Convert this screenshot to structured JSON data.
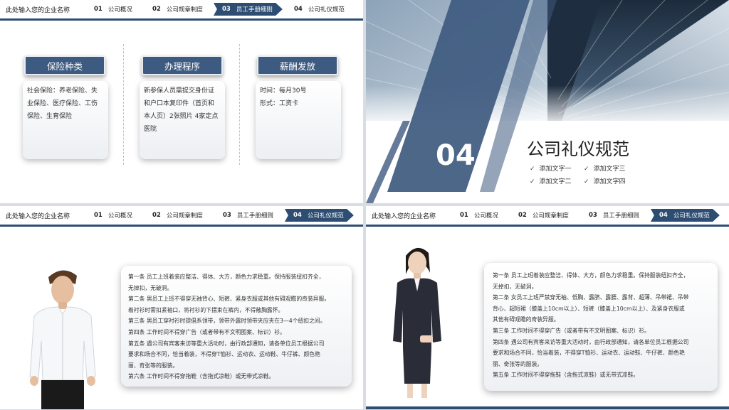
{
  "header": {
    "company": "此处输入您的企业名称",
    "nav": [
      {
        "num": "01",
        "label": "公司概况"
      },
      {
        "num": "02",
        "label": "公司规章制度"
      },
      {
        "num": "03",
        "label": "员工手册细则"
      },
      {
        "num": "04",
        "label": "公司礼仪规范"
      }
    ]
  },
  "slide1": {
    "columns": [
      {
        "title": "保险种类",
        "lines": [
          "社会保险：养老保险、失",
          "业保险、医疗保险、工伤",
          "保险、生育保险"
        ]
      },
      {
        "title": "办理程序",
        "lines": [
          "新参保人员需提交身份证",
          "和户口本复印件（首页和",
          "本人页）2张照片 4家定点",
          "医院"
        ]
      },
      {
        "title": "薪酬发放",
        "lines": [
          "时间：每月30号",
          "形式：工资卡"
        ]
      }
    ]
  },
  "slide2": {
    "number": "04",
    "title": "公司礼仪规范",
    "items": [
      "添加文字一",
      "添加文字三",
      "添加文字二",
      "添加文字四"
    ]
  },
  "slide3": {
    "lines": [
      "第一条 员工上班着装应整洁、得体、大方，颜色力求稳重。保持服装纽扣齐全，",
      "无掉扣，无破洞。",
      "第二条 男员工上班不得穿无袖背心、短裤、紧身衣服或其他有碍观瞻的奇装异服。",
      "着衬衫时需扣紧袖口，将衬衫的下摆束在裤内，不得敞胸露怀。",
      "第三条 男员工穿衬衫时提倡系领带，领带外露时领带夹应夹在3—4个纽扣之间。",
      "第四条 工作时间不得穿广告（或者带有不文明图案、标识）衫。",
      "第五条 遇公司有宾客来访等重大活动时，由行政部通知，请各单位员工根据公司",
      "要求和场合不同，恰当着装，不得穿T恤衫、运动衣、运动鞋、牛仔裤、颜色艳",
      "丽、奇张等的服装。",
      "第六条 工作时间不得穿拖鞋（含拖式凉鞋）或无带式凉鞋。"
    ]
  },
  "slide4": {
    "lines": [
      "第一条 员工上班着装应整洁、得体、大方，颜色力求稳重。保持服装纽扣齐全，",
      "无掉扣，无破洞。",
      "第二条 女员工上班严禁穿无袖、低胸、露脐、露腰、露背、超薄、吊带裙、吊带",
      "背心、超短裙（膝盖上10cm以上）、短裤（膝盖上10cm以上）、及紧身衣服或",
      "其他有碍观瞻的奇装异服。",
      "第三条 工作时间不得穿广告（或者带有不文明图案、标识）衫。",
      "第四条 遇公司有宾客来访等重大活动时，由行政部通知，请各单位员工根据公司",
      "要求和场合不同，恰当着装，不得穿T恤衫、运动衣、运动鞋、牛仔裤、颜色艳",
      "丽、奇张等的服装。",
      "第五条 工作时间不得穿拖鞋（含拖式凉鞋）或无带式凉鞋。"
    ]
  },
  "colors": {
    "accent": "#2e4d73",
    "title_box": "#3d5a80"
  }
}
